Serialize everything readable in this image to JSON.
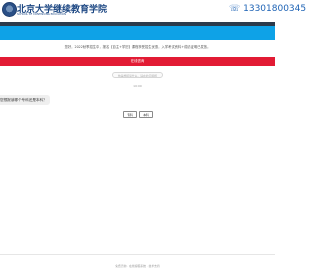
{
  "header": {
    "logo_cn": "北京大学继续教育学院",
    "logo_en": "SCHOOL OF CONTINUING EDUCATION",
    "hotline": "☏ 13301800345",
    "colors": {
      "brand_blue": "#1b4682",
      "hotline_blue": "#1e63b5",
      "dark_bar": "#2b3a4a",
      "nav_blue": "#0ea2e7"
    }
  },
  "notice": "您好，2022秋季招生中，报名【自主+学历】课程享受招生优惠，入学考试资料+成绩证明已发放。",
  "chat": {
    "title": "在线咨询",
    "title_color": "#e21b34",
    "input_placeholder": "你是想报读什么，请在此问答框",
    "timestamp": "10:00",
    "message": "您想报读哪个专科还是本科？",
    "options": [
      "专科",
      "本科"
    ]
  },
  "footer": {
    "text": "免费咨询  ·  在线客服系统  ·  技术支持"
  }
}
